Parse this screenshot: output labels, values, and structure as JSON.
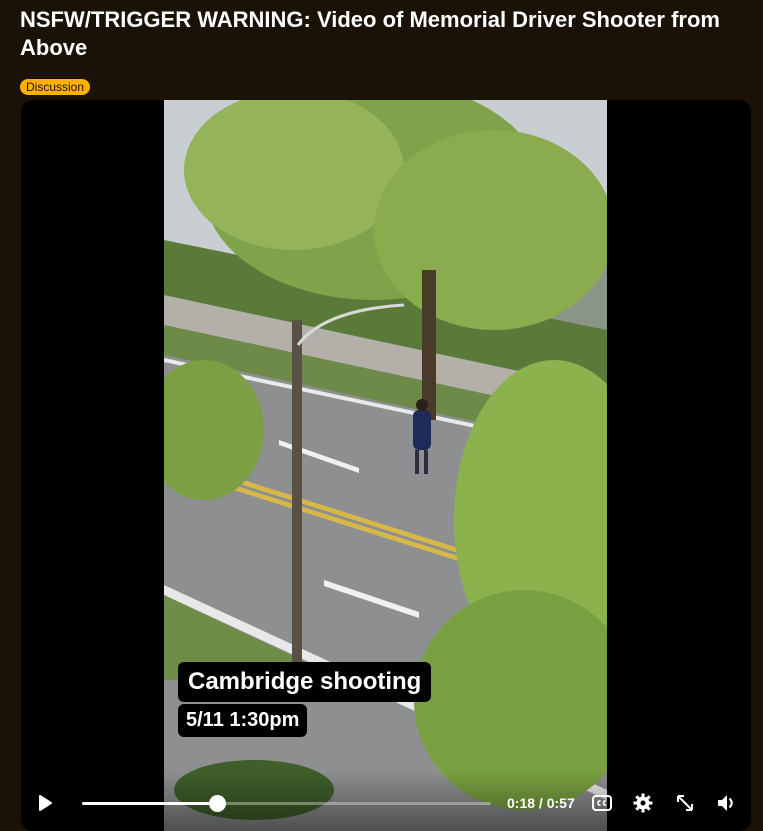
{
  "post": {
    "title": "NSFW/TRIGGER WARNING: Video of Memorial Driver Shooter from Above",
    "flair": "Discussion"
  },
  "video": {
    "caption_title": "Cambridge shooting",
    "caption_time": "5/11 1:30pm"
  },
  "player": {
    "current_time": "0:18",
    "duration": "0:57",
    "time_separator": " / ",
    "progress_fraction": 0.33,
    "icons": {
      "play": "play-icon",
      "cc": "closed-captions-icon",
      "settings": "gear-icon",
      "fullscreen": "expand-icon",
      "volume": "volume-icon"
    }
  },
  "colors": {
    "page_background": "#1a1107",
    "flair_background": "#ffb000",
    "player_background": "#000000"
  }
}
